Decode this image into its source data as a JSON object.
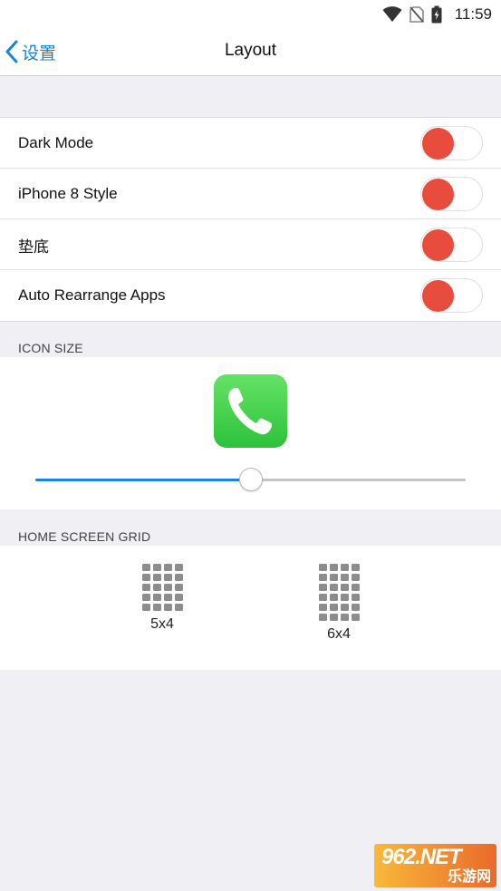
{
  "status_bar": {
    "time": "11:59",
    "icons": [
      "wifi-icon",
      "no-sim-icon",
      "battery-charging-icon"
    ]
  },
  "nav": {
    "back_label": "设置",
    "title": "Layout"
  },
  "settings": {
    "rows": [
      {
        "label": "Dark Mode",
        "toggle_on": false
      },
      {
        "label": "iPhone 8 Style",
        "toggle_on": false
      },
      {
        "label": "垫底",
        "toggle_on": false
      },
      {
        "label": "Auto Rearrange Apps",
        "toggle_on": false
      }
    ]
  },
  "icon_size": {
    "header": "ICON SIZE",
    "app_icon": "phone-app-icon",
    "slider_value": 0.5
  },
  "grid": {
    "header": "HOME SCREEN GRID",
    "options": [
      {
        "label": "5x4",
        "columns": 4,
        "rows": 5
      },
      {
        "label": "6x4",
        "columns": 4,
        "rows": 6
      }
    ]
  },
  "watermark": {
    "top": "962.NET",
    "bottom": "乐游网"
  },
  "colors": {
    "accent": "#1a82e0",
    "toggle_knob": "#e84c3d",
    "app_icon_green": "#4cd964",
    "background": "#efeff4"
  }
}
